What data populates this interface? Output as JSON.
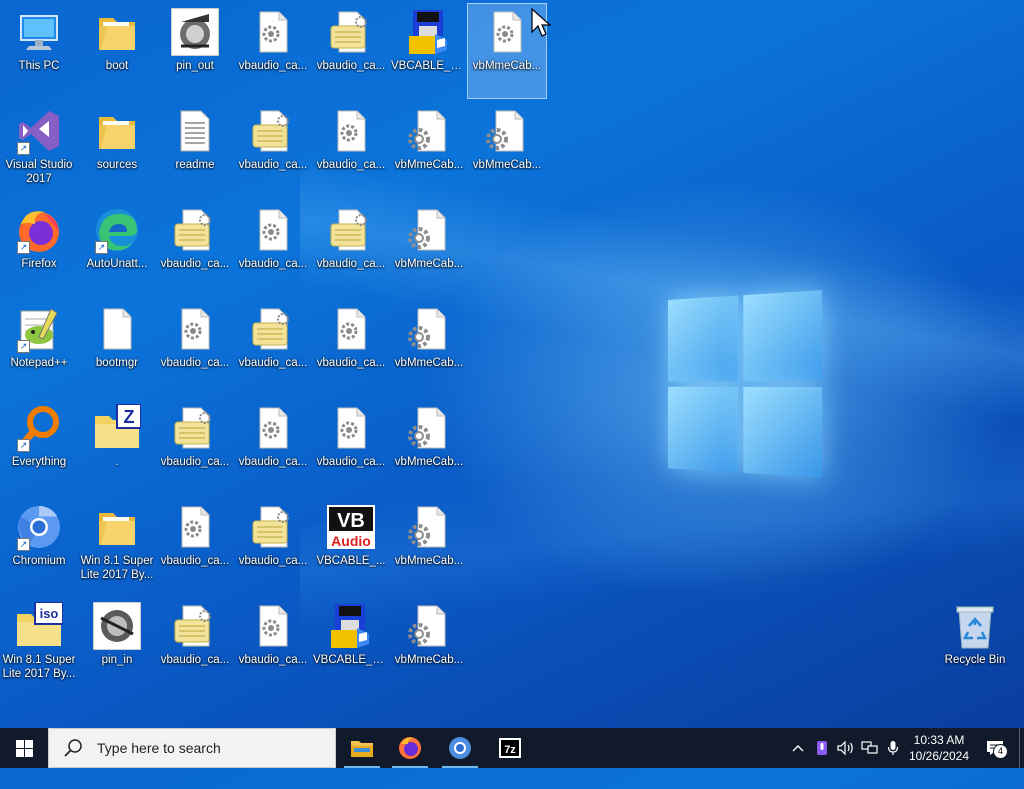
{
  "desktop": {
    "icons": [
      {
        "label": "This PC",
        "icon": "this-pc-icon"
      },
      {
        "label": "boot",
        "icon": "folder-icon"
      },
      {
        "label": "pin_out",
        "icon": "pin-out-app-icon"
      },
      {
        "label": "vbaudio_ca...",
        "icon": "settings-file-icon"
      },
      {
        "label": "vbaudio_ca...",
        "icon": "setup-info-file-icon"
      },
      {
        "label": "VBCABLE_S...",
        "icon": "vbcable-setup-icon"
      },
      {
        "label": "vbMmeCab...",
        "icon": "settings-file-icon"
      },
      {
        "label": "Visual Studio 2017",
        "icon": "visual-studio-icon"
      },
      {
        "label": "sources",
        "icon": "folder-icon"
      },
      {
        "label": "readme",
        "icon": "text-document-icon"
      },
      {
        "label": "vbaudio_ca...",
        "icon": "setup-info-file-icon"
      },
      {
        "label": "vbaudio_ca...",
        "icon": "settings-file-icon"
      },
      {
        "label": "vbMmeCab...",
        "icon": "gear-file-icon"
      },
      {
        "label": "vbMmeCab...",
        "icon": "gear-file-icon"
      },
      {
        "label": "Firefox",
        "icon": "firefox-icon"
      },
      {
        "label": "AutoUnatt...",
        "icon": "edge-icon"
      },
      {
        "label": "vbaudio_ca...",
        "icon": "setup-info-file-icon"
      },
      {
        "label": "vbaudio_ca...",
        "icon": "settings-file-icon"
      },
      {
        "label": "vbaudio_ca...",
        "icon": "setup-info-file-icon"
      },
      {
        "label": "vbMmeCab...",
        "icon": "gear-file-icon"
      },
      {
        "label": "Notepad++",
        "icon": "notepad-plus-plus-icon"
      },
      {
        "label": "bootmgr",
        "icon": "blank-file-icon"
      },
      {
        "label": "vbaudio_ca...",
        "icon": "settings-file-icon"
      },
      {
        "label": "vbaudio_ca...",
        "icon": "setup-info-file-icon"
      },
      {
        "label": "vbaudio_ca...",
        "icon": "settings-file-icon"
      },
      {
        "label": "vbMmeCab...",
        "icon": "gear-file-icon"
      },
      {
        "label": "Everything",
        "icon": "everything-search-icon"
      },
      {
        "label": ".",
        "icon": "zip-folder-icon"
      },
      {
        "label": "vbaudio_ca...",
        "icon": "setup-info-file-icon"
      },
      {
        "label": "vbaudio_ca...",
        "icon": "settings-file-icon"
      },
      {
        "label": "vbaudio_ca...",
        "icon": "settings-file-icon"
      },
      {
        "label": "vbMmeCab...",
        "icon": "gear-file-icon"
      },
      {
        "label": "Chromium",
        "icon": "chromium-icon"
      },
      {
        "label": "Win 8.1 Super Lite 2017 By...",
        "icon": "folder-icon"
      },
      {
        "label": "vbaudio_ca...",
        "icon": "settings-file-icon"
      },
      {
        "label": "vbaudio_ca...",
        "icon": "setup-info-file-icon"
      },
      {
        "label": "VBCABLE_...",
        "icon": "vb-audio-icon"
      },
      {
        "label": "vbMmeCab...",
        "icon": "gear-file-icon"
      },
      {
        "label": "Win 8.1 Super Lite 2017 By...",
        "icon": "iso-file-icon"
      },
      {
        "label": "pin_in",
        "icon": "pin-in-app-icon"
      },
      {
        "label": "vbaudio_ca...",
        "icon": "setup-info-file-icon"
      },
      {
        "label": "vbaudio_ca...",
        "icon": "settings-file-icon"
      },
      {
        "label": "VBCABLE_S...",
        "icon": "vbcable-setup-icon"
      },
      {
        "label": "vbMmeCab...",
        "icon": "gear-file-icon"
      },
      {
        "label": "Recycle Bin",
        "icon": "recycle-bin-icon"
      }
    ]
  },
  "taskbar": {
    "search_placeholder": "Type here to search",
    "apps": [
      {
        "name": "File Explorer",
        "icon": "file-explorer-icon"
      },
      {
        "name": "Firefox",
        "icon": "firefox-icon"
      },
      {
        "name": "Chromium",
        "icon": "chromium-icon"
      },
      {
        "name": "7z",
        "icon": "7zip-icon"
      }
    ],
    "time": "10:33 AM",
    "date": "10/26/2024",
    "notification_count": "4"
  },
  "colors": {
    "accent": "#0a66d0",
    "taskbar": "#101a2a"
  }
}
